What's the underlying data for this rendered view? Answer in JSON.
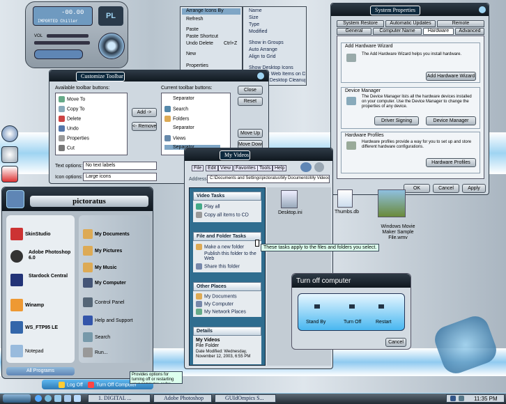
{
  "player": {
    "time": "-00.00",
    "track": "IMPORTED Chiller",
    "vol_label": "VOL",
    "logo": "PL"
  },
  "context_menu": {
    "items": [
      "Arrange Icons By",
      "Refresh",
      "Paste",
      "Paste Shortcut",
      "Undo Delete",
      "New",
      "Properties"
    ],
    "undo_shortcut": "Ctrl+Z",
    "submenu": [
      "Name",
      "Size",
      "Type",
      "Modified",
      "Show in Groups",
      "Auto Arrange",
      "Align to Grid",
      "Show Desktop Icons",
      "Lock Web Items on Desktop",
      "Run Desktop Cleanup Wizard"
    ]
  },
  "customize_toolbar": {
    "title": "Customize Toolbar",
    "available_label": "Available toolbar buttons:",
    "current_label": "Current toolbar buttons:",
    "available": [
      "Move To",
      "Copy To",
      "Delete",
      "Undo",
      "Properties",
      "Cut"
    ],
    "current": [
      "Separator",
      "Search",
      "Folders",
      "Separator",
      "Views",
      "Separator"
    ],
    "add": "Add ->",
    "remove": "<- Remove",
    "close": "Close",
    "reset": "Reset",
    "move_up": "Move Up",
    "move_down": "Move Down",
    "text_options_label": "Text options:",
    "text_options_value": "No text labels",
    "icon_options_label": "Icon options:",
    "icon_options_value": "Large icons"
  },
  "system_properties": {
    "title": "System Properties",
    "tabs_row1": [
      "System Restore",
      "Automatic Updates",
      "Remote"
    ],
    "tabs_row2": [
      "General",
      "Computer Name",
      "Hardware",
      "Advanced"
    ],
    "add_hw_title": "Add Hardware Wizard",
    "add_hw_text": "The Add Hardware Wizard helps you install hardware.",
    "add_hw_btn": "Add Hardware Wizard",
    "dm_title": "Device Manager",
    "dm_text": "The Device Manager lists all the hardware devices installed on your computer. Use the Device Manager to change the properties of any device.",
    "dm_btn1": "Driver Signing",
    "dm_btn2": "Device Manager",
    "hp_title": "Hardware Profiles",
    "hp_text": "Hardware profiles provide a way for you to set up and store different hardware configurations.",
    "hp_btn": "Hardware Profiles",
    "ok": "OK",
    "cancel": "Cancel",
    "apply": "Apply"
  },
  "my_videos": {
    "title": "My Videos",
    "menu": [
      "File",
      "Edit",
      "View",
      "Favorites",
      "Tools",
      "Help"
    ],
    "address_label": "Address",
    "address": "C:\\Documents and Settings\\pictoratus\\My Documents\\My Videos",
    "video_tasks": {
      "title": "Video Tasks",
      "items": [
        "Play all",
        "Copy all items to CD"
      ]
    },
    "file_tasks": {
      "title": "File and Folder Tasks",
      "items": [
        "Make a new folder",
        "Publish this folder to the Web",
        "Share this folder"
      ]
    },
    "other_places": {
      "title": "Other Places",
      "items": [
        "My Documents",
        "My Computer",
        "My Network Places"
      ]
    },
    "details": {
      "title": "Details",
      "name": "My Videos",
      "type": "File Folder",
      "modified": "Date Modified: Wednesday, November 12, 2003, 6:55 PM"
    },
    "files": [
      "Desktop.ini",
      "Thumbs.db",
      "Windows Movie Maker Sample File.wmv"
    ],
    "tooltip": "These tasks apply to the files and folders you select."
  },
  "turn_off": {
    "title": "Turn off computer",
    "standby": "Stand By",
    "turnoff": "Turn Off",
    "restart": "Restart",
    "cancel": "Cancel"
  },
  "start_menu": {
    "user": "pictoratus",
    "left": [
      "SkinStudio",
      "Adobe Photoshop 6.0",
      "Stardock Central",
      "Winamp",
      "WS_FTP95 LE",
      "Notepad"
    ],
    "right": [
      "My Documents",
      "My Pictures",
      "My Music",
      "My Computer",
      "Control Panel",
      "Help and Support",
      "Search",
      "Run..."
    ],
    "all_programs": "All Programs",
    "log_off": "Log Off",
    "turn_off": "Turn Off Computer",
    "tooltip": "Provides options for turning off or restarting your computer, or for activating Stand By or Hibernate modes."
  },
  "taskbar": {
    "tasks": [
      "1. DIGITAL ...",
      "Adobe Photoshop",
      "GUIdOmpics S..."
    ],
    "clock": "11:35 PM"
  }
}
